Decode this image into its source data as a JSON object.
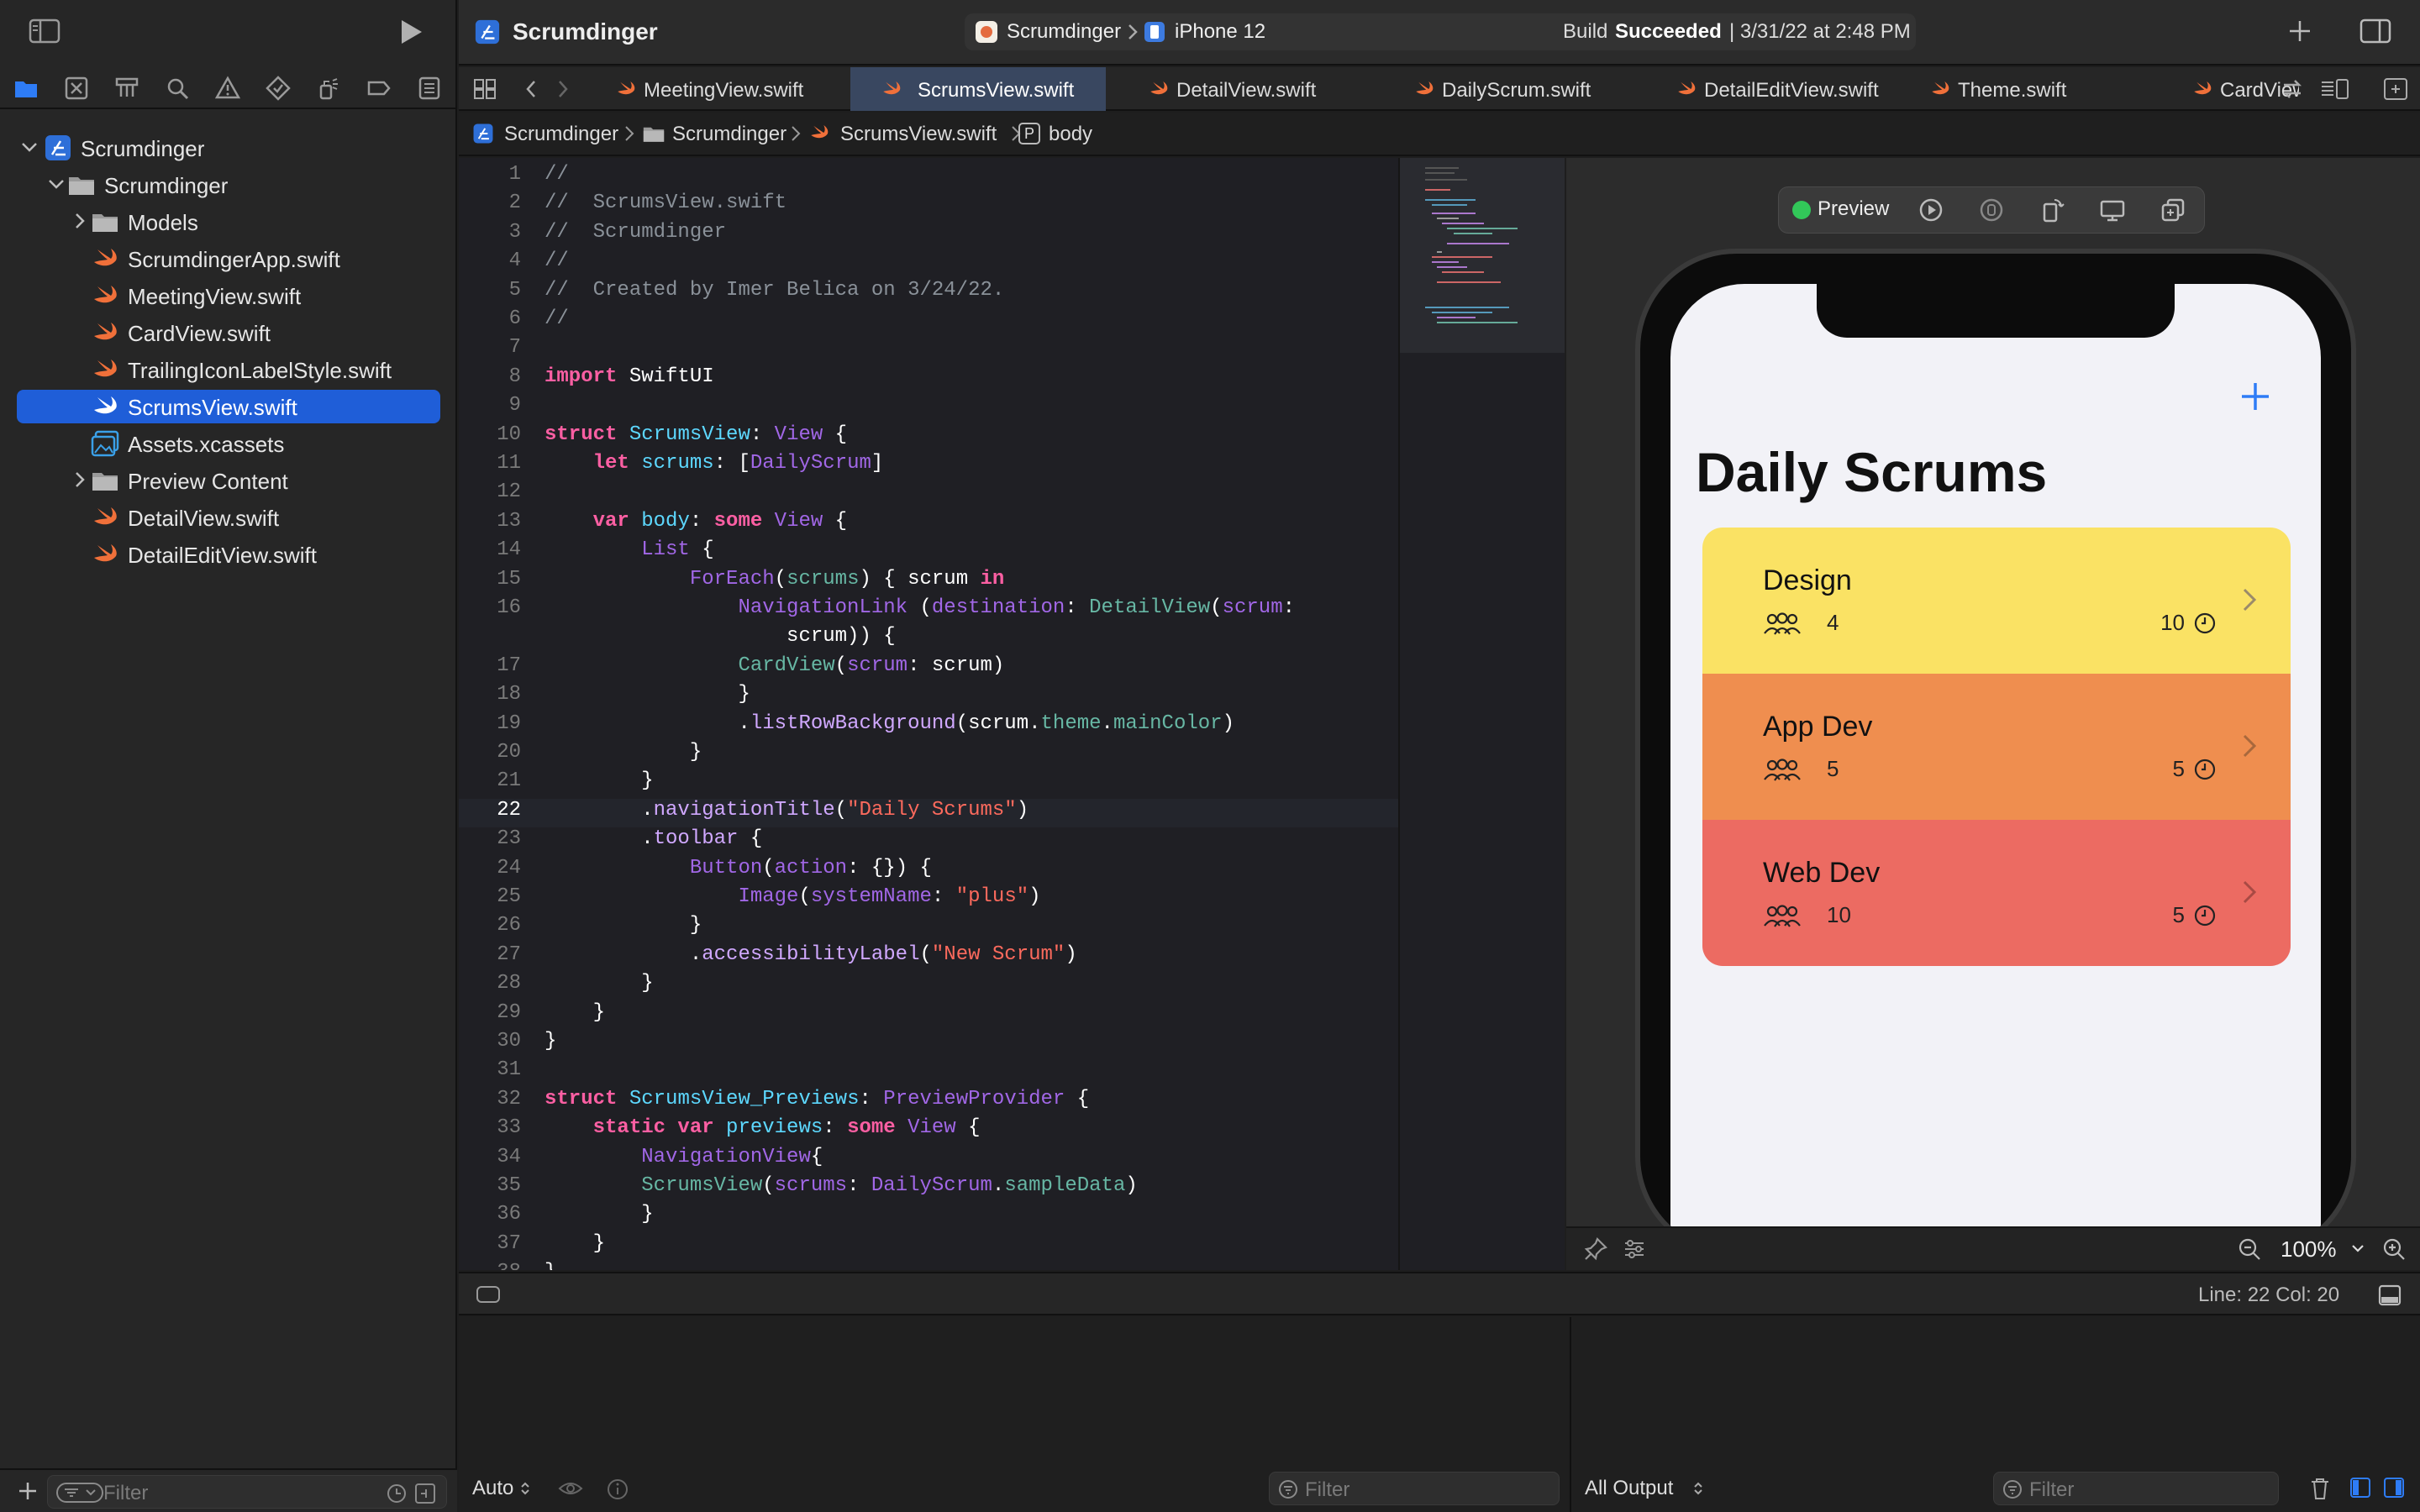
{
  "toolbar": {
    "project_title": "Scrumdinger",
    "scheme_name": "Scrumdinger",
    "destination": "iPhone 12",
    "build_status_prefix": "Build",
    "build_status": "Succeeded",
    "build_time": "| 3/31/22 at 2:48 PM"
  },
  "sidebar": {
    "items": [
      {
        "label": "Scrumdinger"
      },
      {
        "label": "Scrumdinger"
      },
      {
        "label": "Models"
      },
      {
        "label": "ScrumdingerApp.swift"
      },
      {
        "label": "MeetingView.swift"
      },
      {
        "label": "CardView.swift"
      },
      {
        "label": "TrailingIconLabelStyle.swift"
      },
      {
        "label": "ScrumsView.swift"
      },
      {
        "label": "Assets.xcassets"
      },
      {
        "label": "Preview Content"
      },
      {
        "label": "DetailView.swift"
      },
      {
        "label": "DetailEditView.swift"
      }
    ],
    "filter_placeholder": "Filter"
  },
  "tabs": [
    {
      "label": "MeetingView.swift"
    },
    {
      "label": "ScrumsView.swift"
    },
    {
      "label": "DetailView.swift"
    },
    {
      "label": "DailyScrum.swift"
    },
    {
      "label": "DetailEditView.swift"
    },
    {
      "label": "Theme.swift"
    },
    {
      "label": "CardView.sw"
    }
  ],
  "jumpbar": {
    "project": "Scrumdinger",
    "group": "Scrumdinger",
    "file": "ScrumsView.swift",
    "symbol_badge": "P",
    "symbol": "body"
  },
  "preview": {
    "label": "Preview",
    "nav_title": "Daily Scrums",
    "zoom": "100%",
    "cards": [
      {
        "title": "Design",
        "attendees": "4",
        "length": "10",
        "color": "#fae264"
      },
      {
        "title": "App Dev",
        "attendees": "5",
        "length": "5",
        "color": "#ef8e4f"
      },
      {
        "title": "Web Dev",
        "attendees": "10",
        "length": "5",
        "color": "#ec6b62"
      }
    ]
  },
  "status": {
    "cursor": "Line: 22  Col: 20"
  },
  "debug": {
    "mode": "Auto",
    "filter_left": "Filter",
    "output_mode": "All Output",
    "filter_right": "Filter"
  },
  "code": [
    {
      "n": "1",
      "h": "<span class=\"c\">//</span>"
    },
    {
      "n": "2",
      "h": "<span class=\"c\">//  ScrumsView.swift</span>"
    },
    {
      "n": "3",
      "h": "<span class=\"c\">//  Scrumdinger</span>"
    },
    {
      "n": "4",
      "h": "<span class=\"c\">//</span>"
    },
    {
      "n": "5",
      "h": "<span class=\"c\">//  Created by Imer Belica on 3/24/22.</span>"
    },
    {
      "n": "6",
      "h": "<span class=\"c\">//</span>"
    },
    {
      "n": "7",
      "h": ""
    },
    {
      "n": "8",
      "h": "<span class=\"k\">import</span> SwiftUI"
    },
    {
      "n": "9",
      "h": ""
    },
    {
      "n": "10",
      "h": "<span class=\"k\">struct</span> <span class=\"t\">ScrumsView</span>: <span class=\"m\">View</span> {"
    },
    {
      "n": "11",
      "h": "    <span class=\"k\">let</span> <span class=\"t\">scrums</span>: [<span class=\"m\">DailyScrum</span>]"
    },
    {
      "n": "12",
      "h": ""
    },
    {
      "n": "13",
      "h": "    <span class=\"k\">var</span> <span class=\"t\">body</span>: <span class=\"k\">some</span> <span class=\"m\">View</span> {"
    },
    {
      "n": "14",
      "h": "        <span class=\"m\">List</span> {"
    },
    {
      "n": "15",
      "h": "            <span class=\"m\">ForEach</span>(<span class=\"p\">scrums</span>) { scrum <span class=\"k\">in</span>"
    },
    {
      "n": "16",
      "h": "                <span class=\"m\">NavigationLink</span> (<span class=\"m\">destination</span>: <span class=\"p\">DetailView</span>(<span class=\"m\">scrum</span>:"
    },
    {
      "n": "",
      "h": "                    scrum)) {"
    },
    {
      "n": "17",
      "h": "                <span class=\"p\">CardView</span>(<span class=\"m\">scrum</span>: scrum)"
    },
    {
      "n": "18",
      "h": "                }"
    },
    {
      "n": "19",
      "h": "                .<span class=\"x\">listRowBackground</span>(scrum.<span class=\"p\">theme</span>.<span class=\"p\">mainColor</span>)"
    },
    {
      "n": "20",
      "h": "            }"
    },
    {
      "n": "21",
      "h": "        }"
    },
    {
      "n": "22",
      "h": "        .<span class=\"x\">navigationTitle</span>(<span class=\"s\">\"Daily Scrums\"</span>)",
      "cur": true
    },
    {
      "n": "23",
      "h": "        .<span class=\"x\">toolbar</span> {"
    },
    {
      "n": "24",
      "h": "            <span class=\"m\">Button</span>(<span class=\"m\">action</span>: {}) {"
    },
    {
      "n": "25",
      "h": "                <span class=\"m\">Image</span>(<span class=\"m\">systemName</span>: <span class=\"s\">\"plus\"</span>)"
    },
    {
      "n": "26",
      "h": "            }"
    },
    {
      "n": "27",
      "h": "            .<span class=\"x\">accessibilityLabel</span>(<span class=\"s\">\"New Scrum\"</span>)"
    },
    {
      "n": "28",
      "h": "        }"
    },
    {
      "n": "29",
      "h": "    }"
    },
    {
      "n": "30",
      "h": "}"
    },
    {
      "n": "31",
      "h": ""
    },
    {
      "n": "32",
      "h": "<span class=\"k\">struct</span> <span class=\"t\">ScrumsView_Previews</span>: <span class=\"m\">PreviewProvider</span> {"
    },
    {
      "n": "33",
      "h": "    <span class=\"k\">static var</span> <span class=\"t\">previews</span>: <span class=\"k\">some</span> <span class=\"m\">View</span> {"
    },
    {
      "n": "34",
      "h": "        <span class=\"m\">NavigationView</span>{"
    },
    {
      "n": "35",
      "h": "        <span class=\"p\">ScrumsView</span>(<span class=\"m\">scrums</span>: <span class=\"m\">DailyScrum</span>.<span class=\"p\">sampleData</span>)"
    },
    {
      "n": "36",
      "h": "        }"
    },
    {
      "n": "37",
      "h": "    }"
    },
    {
      "n": "38",
      "h": "}"
    }
  ],
  "colors": {
    "accent": "#2e7cf6",
    "swift_orange": "#f0703a",
    "build_green": "#32c759"
  }
}
